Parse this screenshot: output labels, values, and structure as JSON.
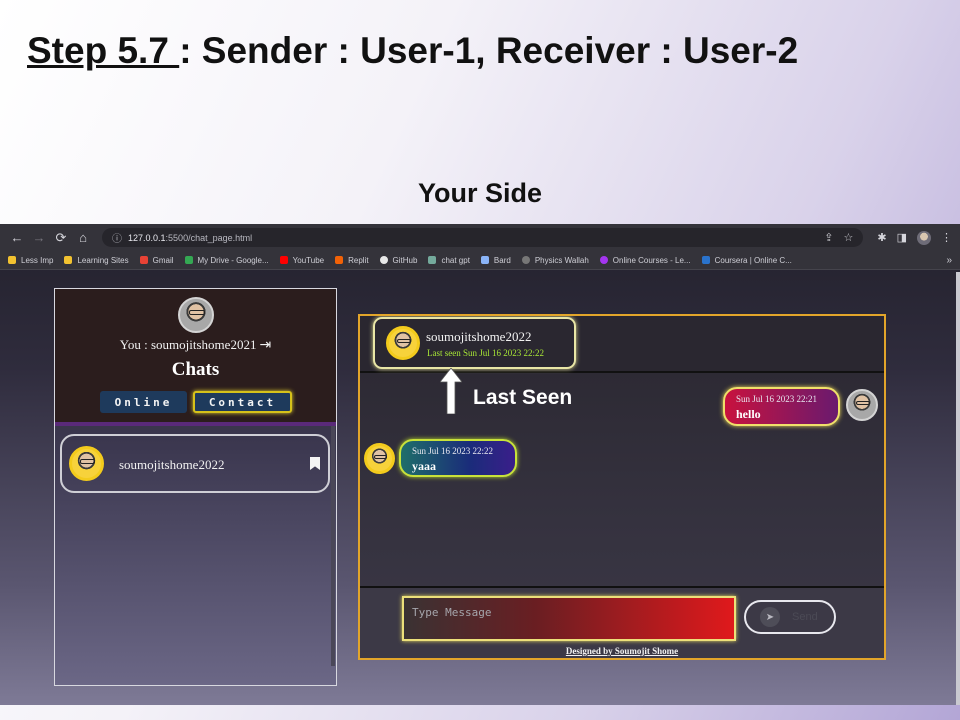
{
  "slide": {
    "title_step": "Step 5.7 ",
    "title_rest": ":  Sender : User-1, Receiver : User-2",
    "subtitle": "Your Side"
  },
  "browser": {
    "url_host": "127.0.0.1",
    "url_path": ":5500/chat_page.html",
    "bookmarks": [
      {
        "label": "Less Imp",
        "color": "#f2c230"
      },
      {
        "label": "Learning Sites",
        "color": "#f2c230"
      },
      {
        "label": "Gmail",
        "color": "#e84235"
      },
      {
        "label": "My Drive - Google...",
        "color": "#34a853"
      },
      {
        "label": "YouTube",
        "color": "#ff0000"
      },
      {
        "label": "Replit",
        "color": "#f26207"
      },
      {
        "label": "GitHub",
        "color": "#e8e8e8"
      },
      {
        "label": "chat gpt",
        "color": "#74aa9c"
      },
      {
        "label": "Bard",
        "color": "#8ab4f8"
      },
      {
        "label": "Physics Wallah",
        "color": "#777777"
      },
      {
        "label": "Online Courses - Le...",
        "color": "#a435f0"
      },
      {
        "label": "Coursera | Online C...",
        "color": "#2a73cc"
      }
    ],
    "bookmarks_more": "»"
  },
  "left_panel": {
    "you_label": "You : soumojitshome2021",
    "chats_title": "Chats",
    "tab_online": "Online",
    "tab_contact": "Contact",
    "contact_name": "soumojitshome2022"
  },
  "chat": {
    "receiver_name": "soumojitshome2022",
    "last_seen": "Last seen Sun Jul 16 2023 22:22",
    "messages": [
      {
        "direction": "sent",
        "time": "Sun Jul 16 2023 22:21",
        "text": "hello"
      },
      {
        "direction": "received",
        "time": "Sun Jul 16 2023 22:22",
        "text": "yaaa"
      }
    ],
    "input_placeholder": "Type Message",
    "send_label": "Send",
    "footer_credit": "Designed by Soumojit Shome"
  },
  "annotation": {
    "label": "Last Seen"
  }
}
